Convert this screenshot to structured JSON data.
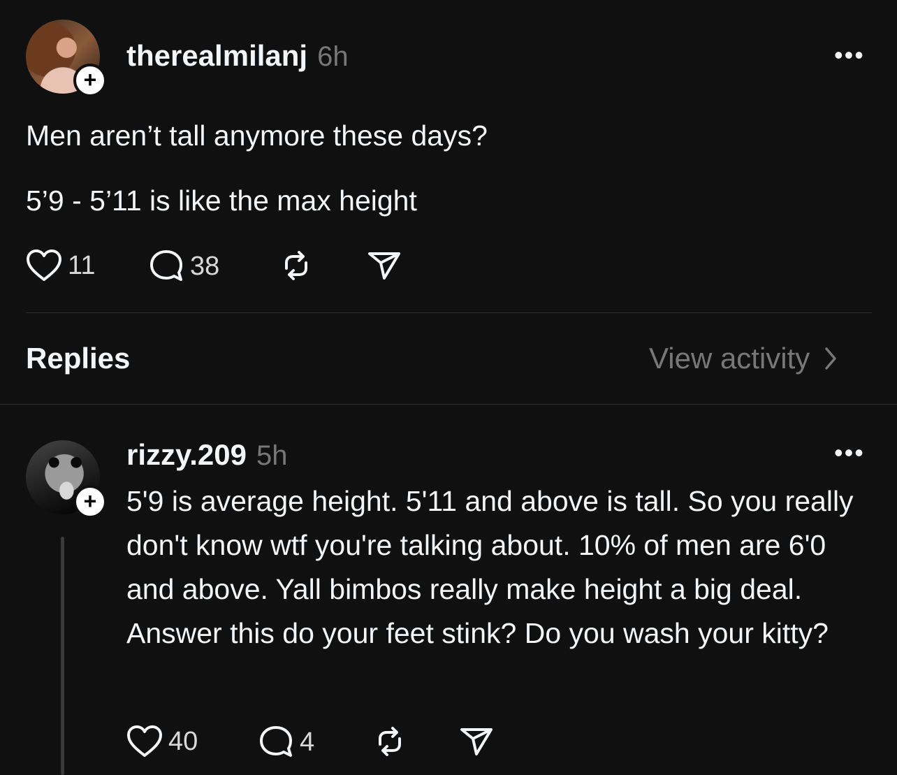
{
  "post": {
    "username": "therealmilanj",
    "time": "6h",
    "more": "•••",
    "text_line1": "Men aren’t tall anymore these days?",
    "text_line2": "5’9 - 5’11 is like the max height",
    "likes": "11",
    "replies": "38",
    "plus": "+",
    "avatar_icon": "profile-photo",
    "icons": [
      "heart-icon",
      "comment-icon",
      "repost-icon",
      "share-icon"
    ]
  },
  "section": {
    "title": "Replies",
    "view_activity": "View activity",
    "chevron": "›"
  },
  "reply": {
    "username": "rizzy.209",
    "time": "5h",
    "more": "•••",
    "text": "5'9 is average height.  5'11 and above is tall. So you really don't know wtf you're talking about. 10% of men are 6'0 and above. Yall bimbos really make height a big deal. Answer this do your feet stink? Do you wash your kitty?",
    "likes": "40",
    "replies": "4",
    "plus": "+"
  },
  "colors": {
    "background": "#101010",
    "text": "#f3f5f7",
    "muted": "#777777",
    "divider": "#2d2d2d"
  }
}
